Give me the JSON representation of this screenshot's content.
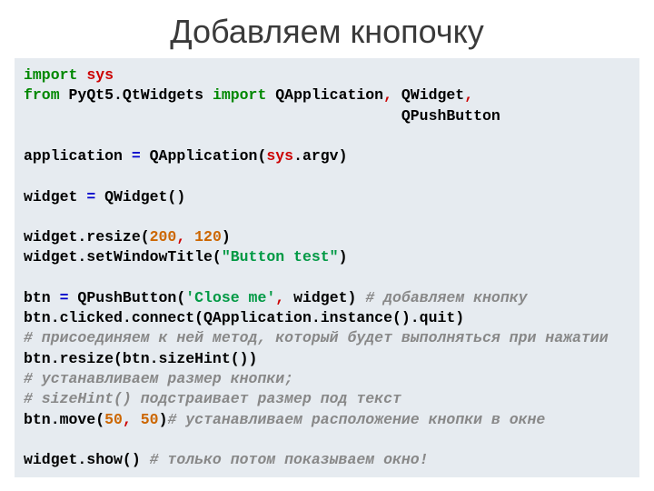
{
  "title": "Добавляем кнопочку",
  "code": {
    "l1_import": "import",
    "l1_sys": "sys",
    "l2_from": "from",
    "l2_pkg": " PyQt5.QtWidgets ",
    "l2_import": "import",
    "l2_qapp": " QApplication",
    "l2_comma1": ",",
    "l2_qwidget": " QWidget",
    "l2_comma2": ",",
    "l3_pad": "                                          ",
    "l3_qpb": "QPushButton",
    "l5_app": "application ",
    "l5_eq": "=",
    "l5_call": " QApplication(",
    "l5_sys": "sys",
    "l5_argv": ".argv)",
    "l7_w": "widget ",
    "l7_eq": "=",
    "l7_rest": " QWidget()",
    "l9_resize_a": "widget.resize(",
    "l9_n1": "200",
    "l9_c": ",",
    "l9_sp": " ",
    "l9_n2": "120",
    "l9_close": ")",
    "l10_a": "widget.setWindowTitle(",
    "l10_str": "\"Button test\"",
    "l10_close": ")",
    "l12_a": "btn ",
    "l12_eq": "=",
    "l12_b": " QPushButton(",
    "l12_str": "'Close me'",
    "l12_c": ",",
    "l12_d": " widget) ",
    "l12_cmt": "# добавляем кнопку",
    "l13": "btn.clicked.connect(QApplication.instance().quit)",
    "l14_cmt": "# присоединяем к ней метод, который будет выполняться при нажатии",
    "l15": "btn.resize(btn.sizeHint())",
    "l16_cmt": "# устанавливаем размер кнопки;",
    "l17_cmt": "# sizeHint() подстраивает размер под текст",
    "l18_a": "btn.move(",
    "l18_n1": "50",
    "l18_c": ",",
    "l18_sp": " ",
    "l18_n2": "50",
    "l18_close": ")",
    "l18_cmt": "# устанавливаем расположение кнопки в окне",
    "l20_a": "widget.show() ",
    "l20_cmt": "# только потом показываем окно!"
  }
}
